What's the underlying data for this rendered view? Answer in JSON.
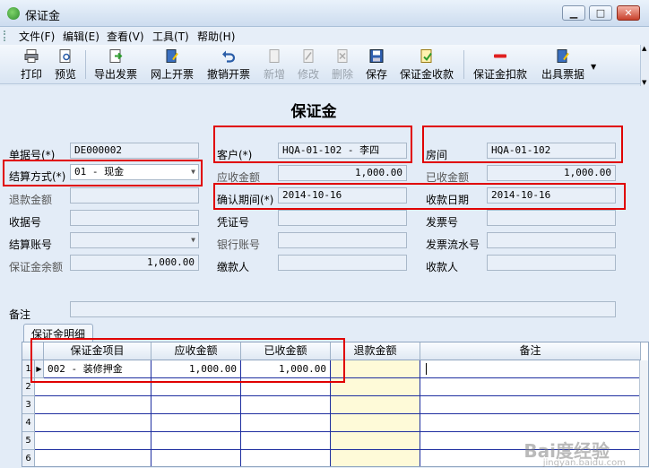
{
  "window": {
    "title": "保证金",
    "min": "▁",
    "max": "□",
    "close": "✕"
  },
  "menu": [
    "文件(F)",
    "编辑(E)",
    "查看(V)",
    "工具(T)",
    "帮助(H)"
  ],
  "toolbar": [
    "打印",
    "预览",
    "导出发票",
    "网上开票",
    "撤销开票",
    "新增",
    "修改",
    "删除",
    "保存",
    "保证金收款",
    "保证金扣款",
    "出具票据"
  ],
  "heading": "保证金",
  "form": {
    "labels": {
      "doc_no": "单据号(*)",
      "settle": "结算方式(*)",
      "refund_amount": "退款金额",
      "receipt_no": "收据号",
      "settle_account": "结算账号",
      "deposit_balance": "保证金余额",
      "customer": "客户(*)",
      "receivable": "应收金额",
      "confirm_date": "确认期间(*)",
      "voucher_no": "凭证号",
      "bank_account": "银行账号",
      "payer": "缴款人",
      "room": "房间",
      "received": "已收金额",
      "collect_date": "收款日期",
      "invoice_no": "发票号",
      "invoice_serial": "发票流水号",
      "collector": "收款人",
      "remark": "备注"
    },
    "values": {
      "doc_no": "DE000002",
      "settle": "01 - 现金",
      "deposit_balance": "1,000.00",
      "customer": "HQA-01-102 - 李四",
      "receivable": "1,000.00",
      "confirm_date": "2014-10-16",
      "room": "HQA-01-102",
      "received": "1,000.00",
      "collect_date": "2014-10-16"
    }
  },
  "detail": {
    "tab": "保证金明细",
    "columns": [
      "保证金项目",
      "应收金额",
      "已收金额",
      "退款金额",
      "备注"
    ],
    "rows": [
      {
        "no": "1",
        "item": "002 - 装修押金",
        "receivable": "1,000.00",
        "received": "1,000.00"
      },
      {
        "no": "2"
      },
      {
        "no": "3"
      },
      {
        "no": "4"
      },
      {
        "no": "5"
      },
      {
        "no": "6"
      }
    ]
  },
  "watermark": {
    "brand": "Bai度经验",
    "url": "jingyan.baidu.com"
  },
  "colors": {
    "highlight": "#e00000",
    "refund_column": "#fefad8"
  }
}
